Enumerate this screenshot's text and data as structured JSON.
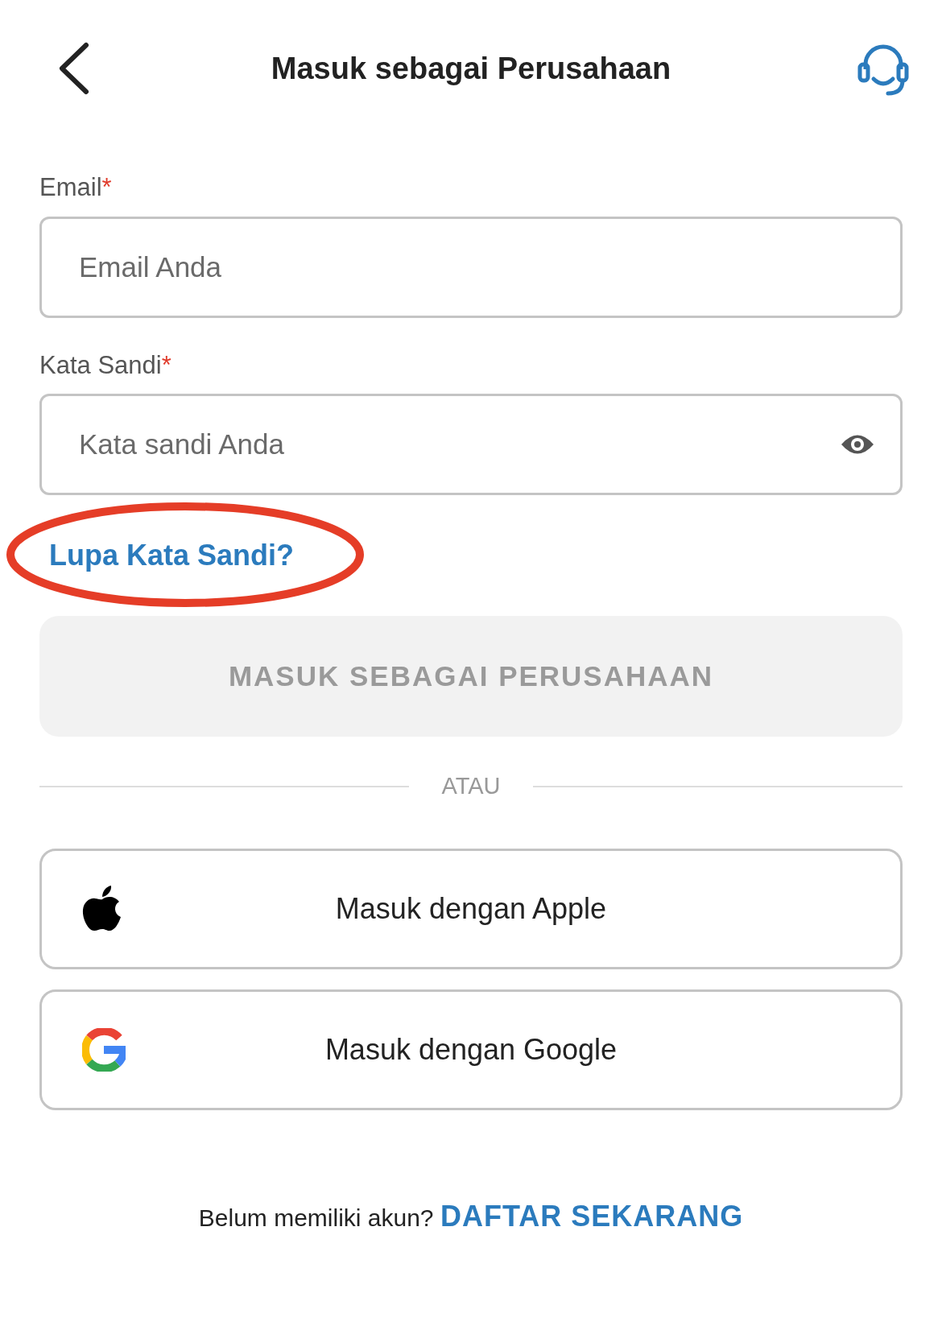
{
  "header": {
    "title": "Masuk sebagai Perusahaan"
  },
  "fields": [
    {
      "label": "Email",
      "required_mark": "*",
      "placeholder": "Email Anda",
      "kind": "text"
    },
    {
      "label": "Kata Sandi",
      "required_mark": "*",
      "placeholder": "Kata sandi Anda",
      "kind": "password"
    }
  ],
  "forgot_link": {
    "text": "Lupa Kata Sandi?",
    "highlighted": true
  },
  "submit_button": {
    "label": "MASUK SEBAGAI PERUSAHAAN",
    "disabled": true
  },
  "divider": {
    "text": "ATAU"
  },
  "social_buttons": [
    {
      "label": "Masuk dengan Apple",
      "kind": "apple"
    },
    {
      "label": "Masuk dengan Google",
      "kind": "google"
    }
  ],
  "footer": {
    "text": "Belum memiliki akun?",
    "link": "DAFTAR SEKARANG"
  }
}
